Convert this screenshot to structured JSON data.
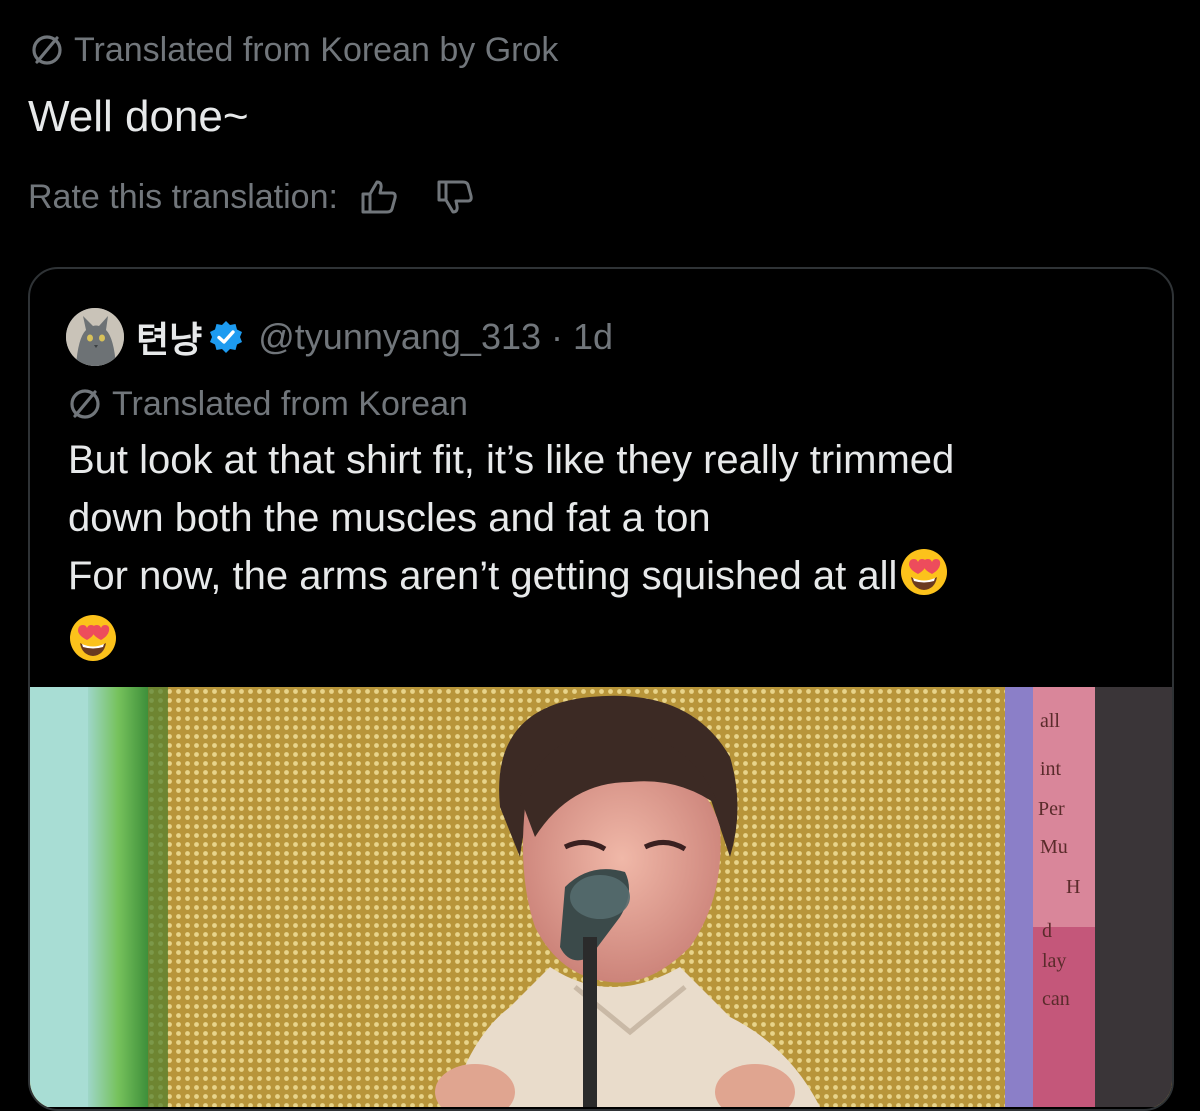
{
  "translation": {
    "icon": "globe-slash-icon",
    "label": "Translated from Korean by Grok"
  },
  "post_text": "Well done~",
  "rating": {
    "label": "Rate this translation:",
    "up_icon": "thumbs-up-icon",
    "down_icon": "thumbs-down-icon"
  },
  "quote": {
    "display_name": "텬냥",
    "verified_color": "#1d9bf0",
    "handle_time": "@tyunnyang_313 · 1d",
    "translated_label": "Translated from Korean",
    "lines": [
      "But look at that shirt fit, it’s like they really trimmed",
      "down both the muscles and fat a ton",
      "For now, the arms aren’t getting squished at all"
    ],
    "emojis": [
      "😍",
      "😍"
    ],
    "media": {
      "description_icon": "video-thumbnail",
      "side_text": [
        "all",
        "int",
        "Per",
        "Mu",
        "H",
        "d",
        "lay",
        "can"
      ]
    }
  },
  "colors": {
    "background": "#000000",
    "text": "#e7e9ea",
    "muted": "#71767b",
    "border": "#2f3336",
    "accent": "#1d9bf0"
  }
}
